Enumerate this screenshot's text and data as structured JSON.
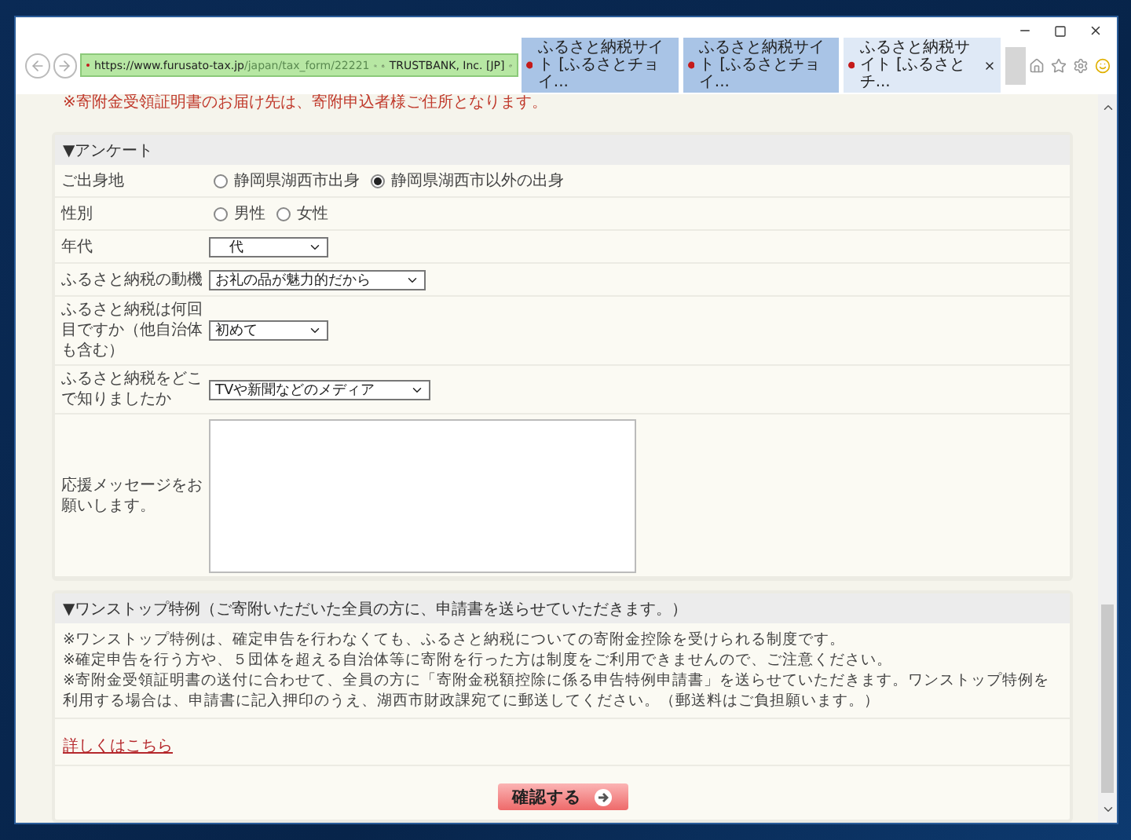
{
  "browser": {
    "url_host": "https://www.furusato-tax.jp",
    "url_path": "/japan/tax_form/22221",
    "certificate": "TRUSTBANK, Inc. [JP]",
    "tabs": [
      {
        "title": "ふるさと納税サイト [ふるさとチョイ...",
        "selected": false
      },
      {
        "title": "ふるさと納税サイト [ふるさとチョイ...",
        "selected": false
      },
      {
        "title": "ふるさと納税サイト [ふるさとチ...",
        "selected": true
      }
    ]
  },
  "notice": "※寄附金受領証明書のお届け先は、寄附申込者様ご住所となります。",
  "survey": {
    "heading": "▼アンケート",
    "rows": [
      {
        "kind": "radio",
        "label": "ご出身地",
        "options": [
          {
            "label": "静岡県湖西市出身",
            "selected": false
          },
          {
            "label": "静岡県湖西市以外の出身",
            "selected": true
          }
        ]
      },
      {
        "kind": "radio",
        "label": "性別",
        "options": [
          {
            "label": "男性",
            "selected": false
          },
          {
            "label": "女性",
            "selected": false
          }
        ]
      },
      {
        "kind": "select",
        "label": "年代",
        "value": "　代"
      },
      {
        "kind": "select",
        "label": "ふるさと納税の動機",
        "value": "お礼の品が魅力的だから"
      },
      {
        "kind": "select",
        "label": "ふるさと納税は何回目ですか（他自治体も含む）",
        "value": "初めて"
      },
      {
        "kind": "select",
        "label": "ふるさと納税をどこで知りましたか",
        "value": "TVや新聞などのメディア"
      },
      {
        "kind": "textarea",
        "label": "応援メッセージをお願いします。"
      }
    ]
  },
  "onestop": {
    "heading": "▼ワンストップ特例（ご寄附いただいた全員の方に、申請書を送らせていただきます。）",
    "paragraphs": [
      "※ワンストップ特例は、確定申告を行わなくても、ふるさと納税についての寄附金控除を受けられる制度です。",
      "※確定申告を行う方や、５団体を超える自治体等に寄附を行った方は制度をご利用できませんので、ご注意ください。",
      "※寄附金受領証明書の送付に合わせて、全員の方に「寄附金税額控除に係る申告特例申請書」を送らせていただきます。ワンストップ特例を利用する場合は、申請書に記入押印のうえ、湖西市財政課宛てに郵送してください。（郵送料はご負担願います。）"
    ],
    "link": "詳しくはこちら",
    "button": "確認する"
  }
}
